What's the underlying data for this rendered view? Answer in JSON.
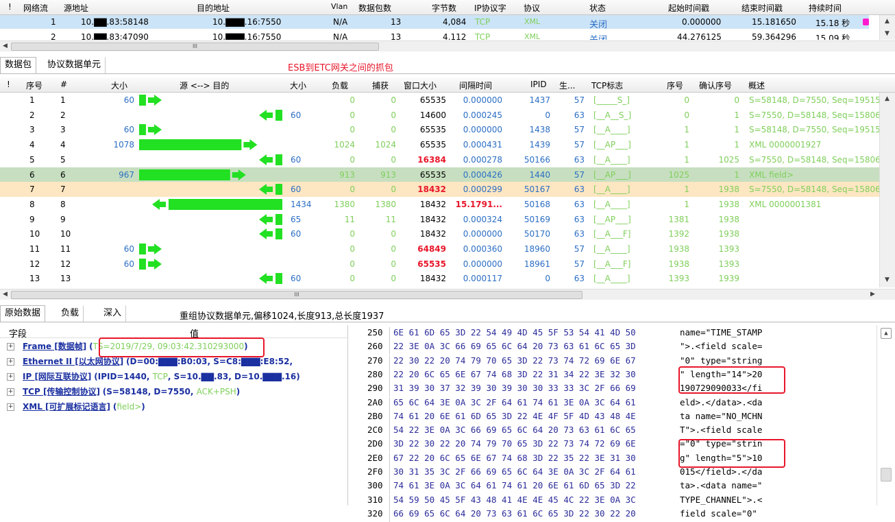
{
  "flows": {
    "headers": [
      "!",
      "网络流",
      "源地址",
      "目的地址",
      "Vlan",
      "数据包数",
      "字节数",
      "IP协议字",
      "协议",
      "状态",
      "起始时间戳",
      "结束时间戳",
      "持续时间"
    ],
    "rows": [
      {
        "id": "1",
        "src": "10.▇▇.83:58148",
        "dst": "10.▇▇▇.16:7550",
        "vlan": "N/A",
        "packets": "13",
        "bytes": "4,084",
        "ipproto": "TCP",
        "proto": "XML",
        "state": "关闭",
        "start": "0.000000",
        "end": "15.181650",
        "dur": "15.18 秒"
      },
      {
        "id": "2",
        "src": "10.▇▇.83:47090",
        "dst": "10.▇▇▇.16:7550",
        "vlan": "N/A",
        "packets": "13",
        "bytes": "4,112",
        "ipproto": "TCP",
        "proto": "XML",
        "state": "关闭",
        "start": "44.276125",
        "end": "59.364296",
        "dur": "15.09 秒"
      }
    ],
    "hscroll_mark": "III"
  },
  "packet_tabs": {
    "tab1": "数据包",
    "tab2": "协议数据单元",
    "note": "ESB到ETC网关之间的抓包"
  },
  "packets": {
    "headers": [
      "!",
      "序号",
      "#",
      "大小",
      "源 <--> 目的",
      "大小",
      "负载",
      "捕获",
      "窗口大小",
      "间隔时间",
      "IPID",
      "生...",
      "TCP标志",
      "序号",
      "确认序号",
      "概述"
    ],
    "hscroll_mark": "III",
    "rows": [
      {
        "seq": "1",
        "num": "1",
        "lsize": "60",
        "dir": "r",
        "bar": 0.06,
        "rsize": "",
        "payload": "0",
        "cap": "0",
        "win": "65535",
        "winRed": false,
        "interval": "0.000000",
        "intRed": false,
        "ipid": "1437",
        "ttl": "57",
        "flags": "[_____S_]",
        "tseq": "0",
        "ack": "0",
        "summary": "S=58148, D=7550, Seq=195152"
      },
      {
        "seq": "2",
        "num": "2",
        "lsize": "",
        "dir": "l",
        "bar": 0.06,
        "rsize": "60",
        "payload": "0",
        "cap": "0",
        "win": "14600",
        "winRed": false,
        "interval": "0.000245",
        "intRed": false,
        "ipid": "0",
        "ttl": "63",
        "flags": "[__A__S_]",
        "tseq": "0",
        "ack": "1",
        "summary": "S=7550, D=58148, Seq=158061"
      },
      {
        "seq": "3",
        "num": "3",
        "lsize": "60",
        "dir": "r",
        "bar": 0.06,
        "rsize": "",
        "payload": "0",
        "cap": "0",
        "win": "65535",
        "winRed": false,
        "interval": "0.000000",
        "intRed": false,
        "ipid": "1438",
        "ttl": "57",
        "flags": "[__A____]",
        "tseq": "1",
        "ack": "1",
        "summary": "S=58148, D=7550, Seq=195152"
      },
      {
        "seq": "4",
        "num": "4",
        "lsize": "1078",
        "dir": "r",
        "bar": 0.9,
        "rsize": "",
        "payload": "1024",
        "cap": "1024",
        "win": "65535",
        "winRed": false,
        "interval": "0.000431",
        "intRed": false,
        "ipid": "1439",
        "ttl": "57",
        "flags": "[__AP___]",
        "tseq": "1",
        "ack": "1",
        "summary": "XML 0000001927"
      },
      {
        "seq": "5",
        "num": "5",
        "lsize": "",
        "dir": "l",
        "bar": 0.06,
        "rsize": "60",
        "payload": "0",
        "cap": "0",
        "win": "16384",
        "winRed": true,
        "interval": "0.000278",
        "intRed": false,
        "ipid": "50166",
        "ttl": "63",
        "flags": "[__A____]",
        "tseq": "1",
        "ack": "1025",
        "summary": "S=7550, D=58148, Seq=158061"
      },
      {
        "seq": "6",
        "num": "6",
        "lsize": "967",
        "dir": "r",
        "bar": 0.8,
        "rsize": "",
        "payload": "913",
        "cap": "913",
        "win": "65535",
        "winRed": false,
        "interval": "0.000426",
        "intRed": false,
        "ipid": "1440",
        "ttl": "57",
        "flags": "[__AP___]",
        "tseq": "1025",
        "ack": "1",
        "summary": "XML field>"
      },
      {
        "seq": "7",
        "num": "7",
        "lsize": "",
        "dir": "l",
        "bar": 0.06,
        "rsize": "60",
        "payload": "0",
        "cap": "0",
        "win": "18432",
        "winRed": true,
        "interval": "0.000299",
        "intRed": false,
        "ipid": "50167",
        "ttl": "63",
        "flags": "[__A____]",
        "tseq": "1",
        "ack": "1938",
        "summary": "S=7550, D=58148, Seq=158061"
      },
      {
        "seq": "8",
        "num": "8",
        "lsize": "",
        "dir": "l",
        "bar": 1.0,
        "rsize": "1434",
        "payload": "1380",
        "cap": "1380",
        "win": "18432",
        "winRed": false,
        "interval": "15.1791...",
        "intRed": true,
        "ipid": "50168",
        "ttl": "63",
        "flags": "[__A____]",
        "tseq": "1",
        "ack": "1938",
        "summary": "XML 0000001381"
      },
      {
        "seq": "9",
        "num": "9",
        "lsize": "",
        "dir": "l",
        "bar": 0.06,
        "rsize": "65",
        "payload": "11",
        "cap": "11",
        "win": "18432",
        "winRed": false,
        "interval": "0.000324",
        "intRed": false,
        "ipid": "50169",
        "ttl": "63",
        "flags": "[__AP___]",
        "tseq": "1381",
        "ack": "1938",
        "summary": ""
      },
      {
        "seq": "10",
        "num": "10",
        "lsize": "",
        "dir": "l",
        "bar": 0.06,
        "rsize": "60",
        "payload": "0",
        "cap": "0",
        "win": "18432",
        "winRed": false,
        "interval": "0.000000",
        "intRed": false,
        "ipid": "50170",
        "ttl": "63",
        "flags": "[__A___F]",
        "tseq": "1392",
        "ack": "1938",
        "summary": ""
      },
      {
        "seq": "11",
        "num": "11",
        "lsize": "60",
        "dir": "r",
        "bar": 0.06,
        "rsize": "",
        "payload": "0",
        "cap": "0",
        "win": "64849",
        "winRed": true,
        "interval": "0.000360",
        "intRed": false,
        "ipid": "18960",
        "ttl": "57",
        "flags": "[__A____]",
        "tseq": "1938",
        "ack": "1393",
        "summary": ""
      },
      {
        "seq": "12",
        "num": "12",
        "lsize": "60",
        "dir": "r",
        "bar": 0.06,
        "rsize": "",
        "payload": "0",
        "cap": "0",
        "win": "65535",
        "winRed": true,
        "interval": "0.000000",
        "intRed": false,
        "ipid": "18961",
        "ttl": "57",
        "flags": "[__A___F]",
        "tseq": "1938",
        "ack": "1393",
        "summary": ""
      },
      {
        "seq": "13",
        "num": "13",
        "lsize": "",
        "dir": "l",
        "bar": 0.06,
        "rsize": "60",
        "payload": "0",
        "cap": "0",
        "win": "18432",
        "winRed": false,
        "interval": "0.000117",
        "intRed": false,
        "ipid": "0",
        "ttl": "63",
        "flags": "[__A____]",
        "tseq": "1393",
        "ack": "1939",
        "summary": ""
      }
    ]
  },
  "detail_tabs": {
    "tab1": "原始数据",
    "tab2": "负载",
    "tab3": "深入",
    "info": "重组协议数据单元,偏移1024,长度913,总长度1937"
  },
  "tree": {
    "col_field": "字段",
    "col_value": "值",
    "items": [
      {
        "name": "Frame [数据帧]",
        "detail": "(TS=2019/7/29, 09:03:42.310293000)"
      },
      {
        "name": "Ethernet II [以太网协议]",
        "detail": "(D=00:▇▇▇:B0:03, S=C8:▇▇▇:E8:52,"
      },
      {
        "name": "IP [网际互联协议]",
        "detail": "(IPID=1440, TCP, S=10.▇▇.83, D=10.▇▇▇.16)"
      },
      {
        "name": "TCP [传输控制协议]",
        "detail": "(S=58148, D=7550, ACK+PSH)"
      },
      {
        "name": "XML [可扩展标记语言]",
        "detail": "(field>)"
      }
    ]
  },
  "hex": {
    "rows": [
      {
        "off": "250",
        "bytes": "6E 61 6D 65 3D 22 54 49 4D 45 5F 53 54 41 4D 50",
        "ascii": "name=\"TIME_STAMP"
      },
      {
        "off": "260",
        "bytes": "22 3E 0A 3C 66 69 65 6C 64 20 73 63 61 6C 65 3D",
        "ascii": "\">.<field scale="
      },
      {
        "off": "270",
        "bytes": "22 30 22 20 74 79 70 65 3D 22 73 74 72 69 6E 67",
        "ascii": "\"0\" type=\"string"
      },
      {
        "off": "280",
        "bytes": "22 20 6C 65 6E 67 74 68 3D 22 31 34 22 3E 32 30",
        "ascii": "\" length=\"14\">20"
      },
      {
        "off": "290",
        "bytes": "31 39 30 37 32 39 30 39 30 30 33 33 3C 2F 66 69",
        "ascii": "190729090033</fi"
      },
      {
        "off": "2A0",
        "bytes": "65 6C 64 3E 0A 3C 2F 64 61 74 61 3E 0A 3C 64 61",
        "ascii": "eld>.</data>.<da"
      },
      {
        "off": "2B0",
        "bytes": "74 61 20 6E 61 6D 65 3D 22 4E 4F 5F 4D 43 48 4E",
        "ascii": "ta name=\"NO_MCHN"
      },
      {
        "off": "2C0",
        "bytes": "54 22 3E 0A 3C 66 69 65 6C 64 20 73 63 61 6C 65",
        "ascii": "T\">.<field scale"
      },
      {
        "off": "2D0",
        "bytes": "3D 22 30 22 20 74 79 70 65 3D 22 73 74 72 69 6E",
        "ascii": "=\"0\" type=\"strin"
      },
      {
        "off": "2E0",
        "bytes": "67 22 20 6C 65 6E 67 74 68 3D 22 35 22 3E 31 30",
        "ascii": "g\" length=\"5\">10"
      },
      {
        "off": "2F0",
        "bytes": "30 31 35 3C 2F 66 69 65 6C 64 3E 0A 3C 2F 64 61",
        "ascii": "015</field>.</da"
      },
      {
        "off": "300",
        "bytes": "74 61 3E 0A 3C 64 61 74 61 20 6E 61 6D 65 3D 22",
        "ascii": "ta>.<data name=\""
      },
      {
        "off": "310",
        "bytes": "54 59 50 45 5F 43 48 41 4E 4E 45 4C 22 3E 0A 3C",
        "ascii": "TYPE_CHANNEL\">.<"
      },
      {
        "off": "320",
        "bytes": "66 69 65 6C 64 20 73 63 61 6C 65 3D 22 30 22 20",
        "ascii": "field scale=\"0\" "
      }
    ]
  },
  "colors": {
    "selected_row": "#cce4f7",
    "highlight_green": "#c7dfc0",
    "highlight_orange": "#fde6c2",
    "arrow_green": "#22e022",
    "accent_red": "#e8162a",
    "tree_blue": "#1a2fa0"
  }
}
